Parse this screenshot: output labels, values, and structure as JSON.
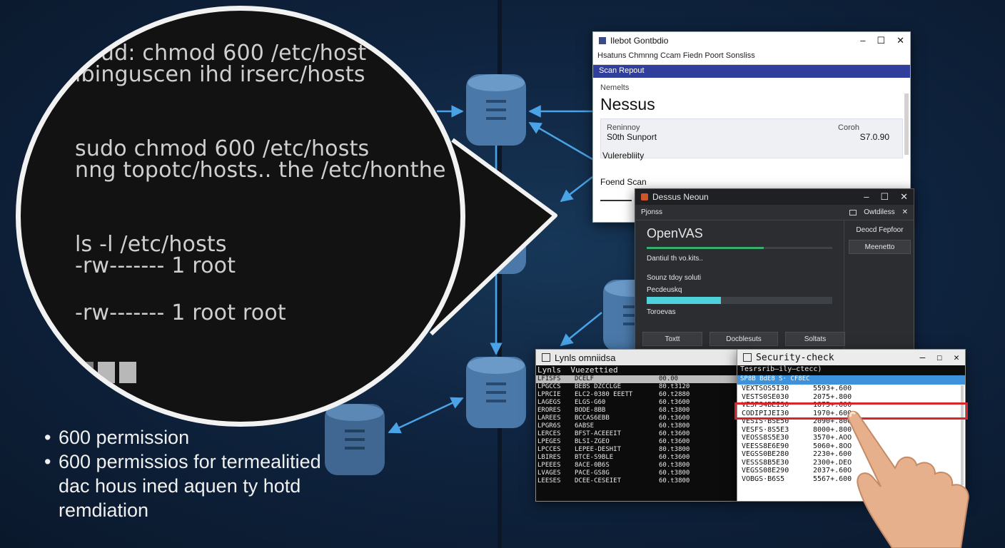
{
  "terminal": {
    "lines": [
      " :sud: chmod 600 /etc/host",
      "ibinguscen ihd irserc/hosts",
      "sudo chmod 600 /etc/hosts",
      "nng topotc/hosts.. the /etc/honthe",
      "ls -l /etc/hosts",
      "-rw------- 1 root",
      "-rw------- 1 root root"
    ]
  },
  "bullets": [
    {
      "text": "600 permission"
    },
    {
      "text": "600 permissios for termealitied"
    },
    {
      "text": "dac hous ined aquen ty hotd"
    },
    {
      "text": "remdiation"
    }
  ],
  "nessus_window": {
    "title": "Ilebot Gontbdio",
    "menu": "Hsatuns Chmnng Ccam   Fiedn Poort Sonsliss",
    "selected_row": "Scan Repout",
    "label_top": "Nemelts",
    "app_name": "Nessus",
    "panel_label_left": "Reninnoy",
    "panel_value_left": "S0th Sunport",
    "panel_label_right": "Coroh",
    "panel_value_right": "S7.0.90",
    "vulnerability_label": "Vulerebliity",
    "found_scan_label": "Foend Scan",
    "controls": [
      "–",
      "☐",
      "✕"
    ]
  },
  "openvas_window": {
    "title": "Dessus Neoun",
    "sub_left": "Pjonss",
    "sub_right": "Owtdiless",
    "app_name": "OpenVAS",
    "status_1": "Dantiul th vo.kits..",
    "status_2": "Sounz tdoy soluti",
    "progress_label": "Pecdeuskq",
    "progress_1": 0.63,
    "progress_2": 0.4,
    "footer_label": "Toroevas",
    "buttons": [
      "Toxtt",
      "Docblesuts",
      "Soltats"
    ],
    "right_title": "Deocd Fepfoor",
    "right_button": "Meenetto",
    "controls": [
      "–",
      "☐",
      "✕"
    ],
    "colors": {
      "progress_green": "#35b06a",
      "progress_cyan": "#4fd1dc"
    }
  },
  "lynis_window": {
    "title": "Lynls omniidsa",
    "header": "Lynls  Vuezettied",
    "rows": [
      [
        "LFISFS",
        "DCELF",
        "00.00"
      ],
      [
        "LPGCCS",
        "BEBS DZCCLGE",
        "80.t3120"
      ],
      [
        "LPRCIE",
        "ELC2-0380 EEETT",
        "60.t2880"
      ],
      [
        "LAGEGS",
        "ELGS-G60",
        "60.t3600"
      ],
      [
        "ERORES",
        "BODE-8BB",
        "68.t3800"
      ],
      [
        "LAREES",
        "BCCAS6EBB",
        "60.t3600"
      ],
      [
        "LPGR6S",
        "6ABSE",
        "60.t3800"
      ],
      [
        "LERCES",
        "BFST-ACEEEIT",
        "60.t3600"
      ],
      [
        "LPEGES",
        "BLSI-ZGEO",
        "60.t3600"
      ],
      [
        "LPCCES",
        "LEPEE-DESHIT",
        "80.t3800"
      ],
      [
        "LBIRES",
        "BTCE-S9BLE",
        "60.t3600"
      ],
      [
        "LPEEES",
        "8ACE-0B6S",
        "60.t3800"
      ],
      [
        "LVAGES",
        "PACE-GS8G",
        "60.t3800"
      ],
      [
        "LEESES",
        "DCEE-CESEIET",
        "60.t3800"
      ]
    ]
  },
  "security_window": {
    "title": "Security-check",
    "command": "Tesrsrib–ily–ctecc)",
    "header": "SP8B  BdE8 S· CF8EC",
    "rows": [
      [
        "VEXTSOS5I30",
        "5593+.600"
      ],
      [
        "VESTS0SE030",
        "2075+.800"
      ],
      [
        "VESFS4BEI30",
        "1875+.600"
      ],
      [
        "CODIPIJEI30",
        "1970+.600"
      ],
      [
        "VESIS·BSE50",
        "2090+.800"
      ],
      [
        "VESFS·8S5E3",
        "8000+.800"
      ],
      [
        "VEOSS8S5E30",
        "3570+.AOO"
      ],
      [
        "VEESS8E6E90",
        "5060+.8OO"
      ],
      [
        "VEGSS0BE280",
        "2230+.600"
      ],
      [
        "VESSS8B5E30",
        "2300+.DEO"
      ],
      [
        "VEGSS08E290",
        "2037+.60O"
      ],
      [
        "VOBGS·B6S5",
        "5567+.600"
      ]
    ],
    "highlighted_row_index": 3,
    "highlight_color": "#d7262b",
    "controls": [
      "–",
      "☐",
      "✕"
    ]
  }
}
